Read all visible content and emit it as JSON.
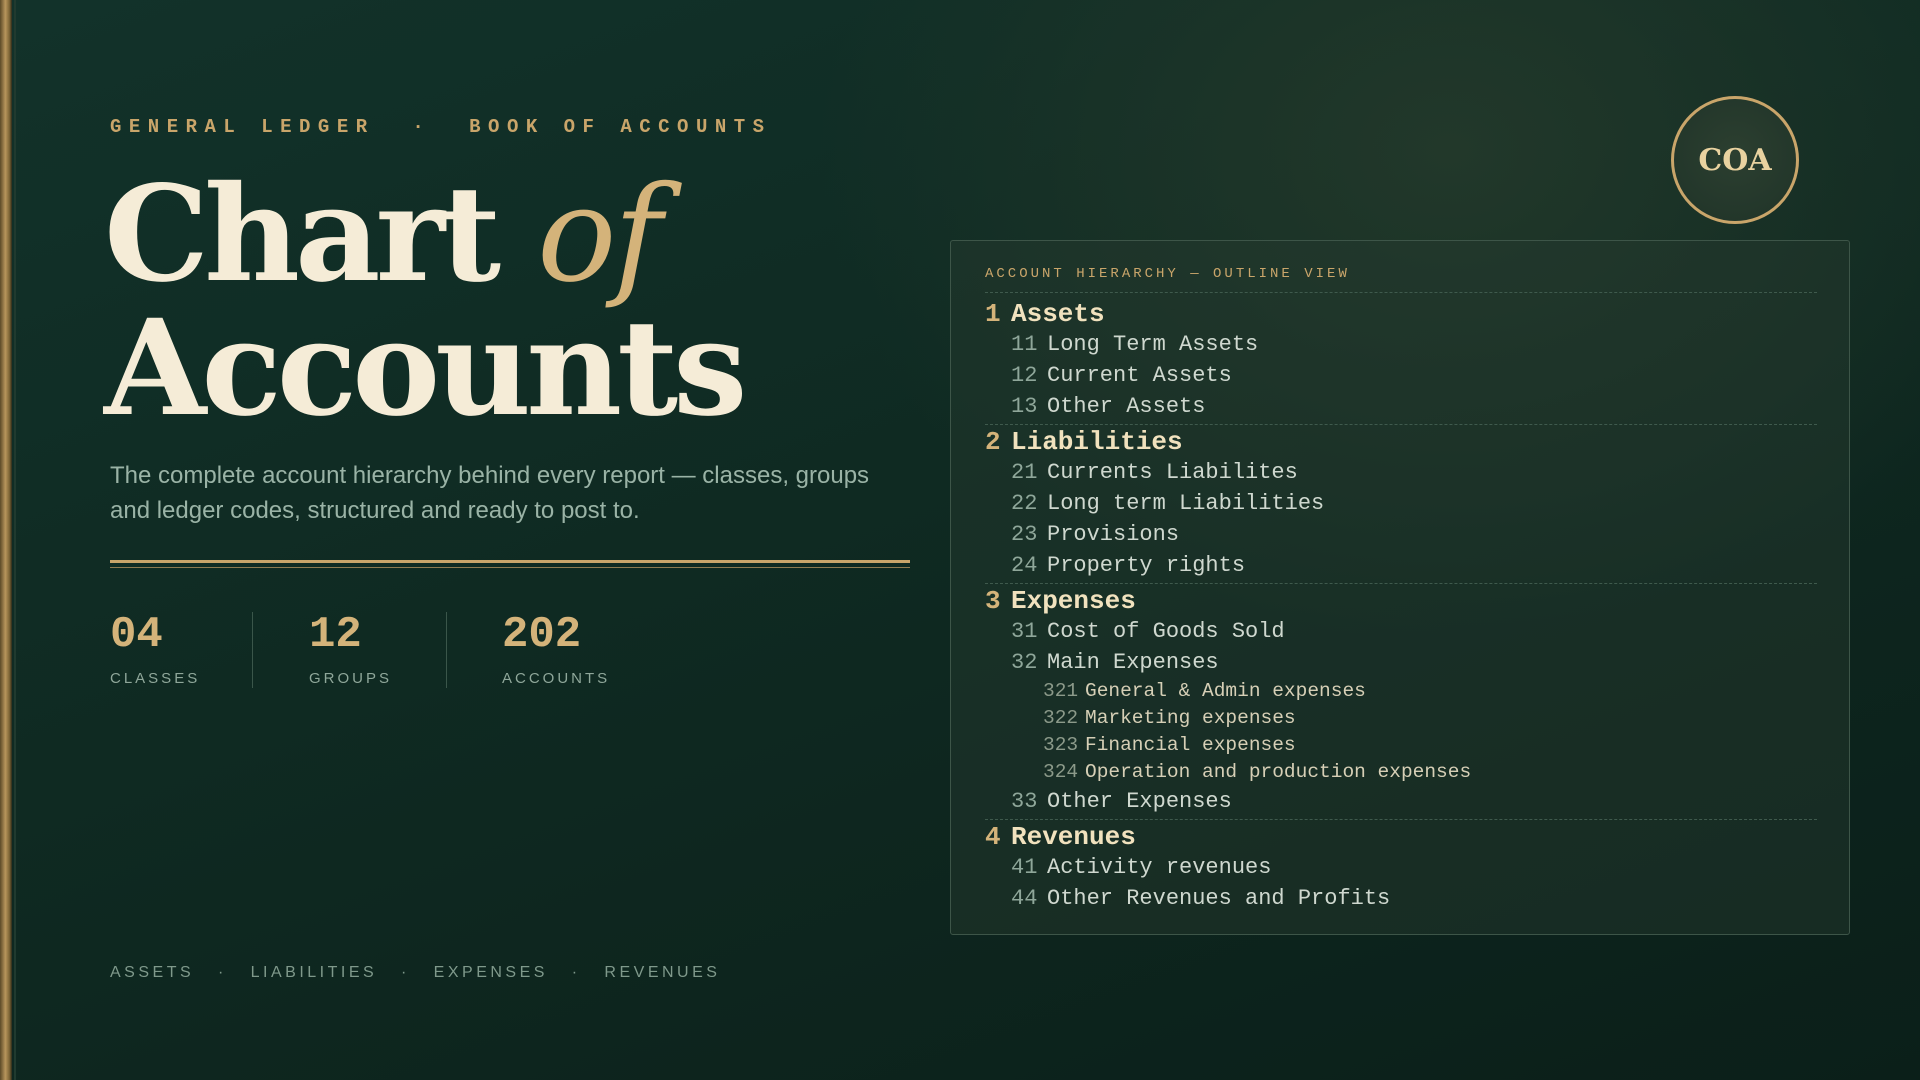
{
  "eyebrow": "GENERAL LEDGER  ·  BOOK OF ACCOUNTS",
  "title": {
    "word1": "Chart",
    "word2": "of",
    "word3": "Accounts"
  },
  "subtitle": "The complete account hierarchy behind every report — classes, groups and ledger codes, structured and ready to post to.",
  "stats": [
    {
      "value": "04",
      "label": "CLASSES"
    },
    {
      "value": "12",
      "label": "GROUPS"
    },
    {
      "value": "202",
      "label": "ACCOUNTS"
    }
  ],
  "footer": "ASSETS   ·   LIABILITIES   ·   EXPENSES   ·   REVENUES",
  "seal": "COA",
  "panel": {
    "heading": "ACCOUNT HIERARCHY — OUTLINE VIEW",
    "classes": [
      {
        "code": "1",
        "name": "Assets",
        "groups": [
          {
            "code": "11",
            "name": "Long Term Assets"
          },
          {
            "code": "12",
            "name": "Current Assets"
          },
          {
            "code": "13",
            "name": "Other Assets"
          }
        ]
      },
      {
        "code": "2",
        "name": "Liabilities",
        "groups": [
          {
            "code": "21",
            "name": "Currents Liabilites"
          },
          {
            "code": "22",
            "name": "Long term Liabilities"
          },
          {
            "code": "23",
            "name": "Provisions"
          },
          {
            "code": "24",
            "name": "Property rights"
          }
        ]
      },
      {
        "code": "3",
        "name": "Expenses",
        "groups": [
          {
            "code": "31",
            "name": "Cost of Goods Sold"
          },
          {
            "code": "32",
            "name": "Main Expenses"
          },
          {
            "code": "321",
            "name": "General & Admin expenses",
            "level": 3
          },
          {
            "code": "322",
            "name": "Marketing expenses",
            "level": 3
          },
          {
            "code": "323",
            "name": "Financial expenses",
            "level": 3
          },
          {
            "code": "324",
            "name": "Operation and production expenses",
            "level": 3
          },
          {
            "code": "33",
            "name": "Other Expenses"
          }
        ]
      },
      {
        "code": "4",
        "name": "Revenues",
        "groups": [
          {
            "code": "41",
            "name": "Activity revenues"
          },
          {
            "code": "44",
            "name": "Other Revenues and Profits"
          }
        ]
      }
    ]
  }
}
